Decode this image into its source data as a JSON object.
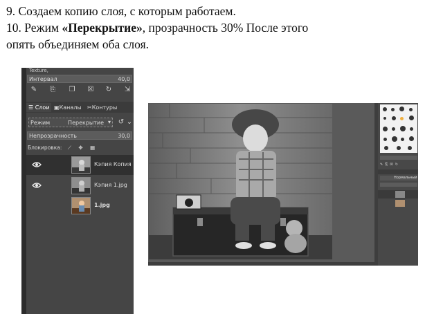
{
  "instructions": {
    "line1": "9. Создаем копию слоя, с которым работаем.",
    "line2_prefix": "10. Режим ",
    "line2_bold": "«Перекрытие»",
    "line2_suffix": ",  прозрачность  30%  После этого",
    "line3": "опять объединяем оба слоя."
  },
  "layers_panel": {
    "texture_label": "Texture,",
    "interval_label": "Интервал",
    "interval_value": "40,0",
    "tabs": [
      "Слои",
      "Каналы",
      "Контуры"
    ],
    "mode_label": "Режим",
    "mode_value": "Перекрытие",
    "opacity_label": "Непрозрачность",
    "opacity_value": "30,0",
    "lock_label": "Блокировка:",
    "layers": [
      {
        "name": "Кэпия Копия",
        "visible": true,
        "selected": true,
        "bold": false
      },
      {
        "name": "Кэпия 1.jpg",
        "visible": true,
        "selected": false,
        "bold": false
      },
      {
        "name": "1.jpg",
        "visible": false,
        "selected": false,
        "bold": true
      }
    ]
  },
  "dock": {
    "mode_value": "Нормальный"
  },
  "colors": {
    "panel_bg": "#454545",
    "selected_row": "#303030",
    "field_bg": "#5c5c5c"
  }
}
